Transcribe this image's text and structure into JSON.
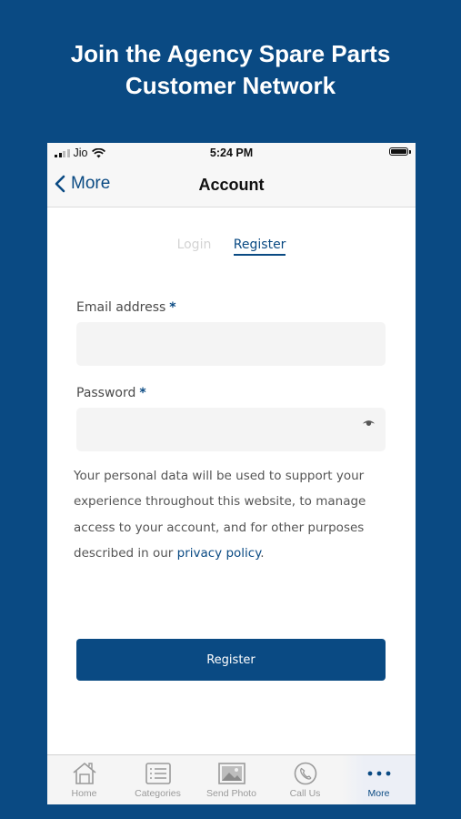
{
  "headline": {
    "line1": "Join the Agency Spare Parts",
    "line2": "Customer Network"
  },
  "status_bar": {
    "carrier": "Jio",
    "time": "5:24 PM"
  },
  "nav": {
    "back_label": "More",
    "title": "Account"
  },
  "tabs": {
    "login": "Login",
    "register": "Register"
  },
  "form": {
    "email_label": "Email address",
    "password_label": "Password",
    "required_mark": "*",
    "email_value": "",
    "password_value": ""
  },
  "privacy": {
    "text": "Your personal data will be used to support your experience throughout this website, to manage access to your account, and for other purposes described in our ",
    "link": "privacy policy",
    "end": "."
  },
  "register_button": "Register",
  "tab_bar": {
    "items": [
      {
        "label": "Home",
        "icon": "home-icon"
      },
      {
        "label": "Categories",
        "icon": "list-icon"
      },
      {
        "label": "Send Photo",
        "icon": "photo-icon"
      },
      {
        "label": "Call Us",
        "icon": "phone-icon"
      },
      {
        "label": "More",
        "icon": "more-dots-icon"
      }
    ],
    "active": "More"
  },
  "colors": {
    "brand": "#0a4a83",
    "field_bg": "#f4f4f4",
    "muted_tab": "#d3d3d3"
  }
}
